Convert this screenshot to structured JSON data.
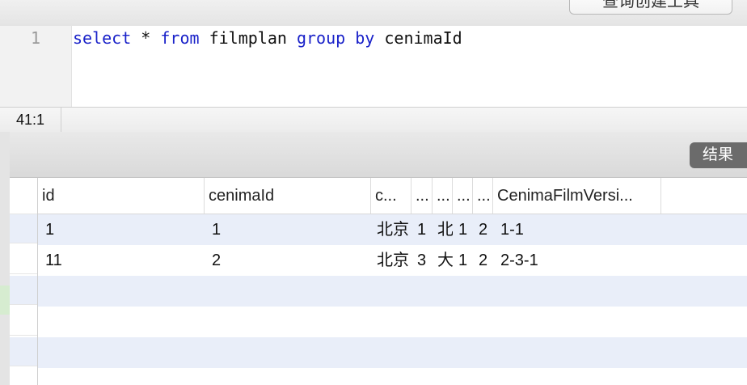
{
  "toolbar": {
    "query_builder_button": "查询创建工具"
  },
  "editor": {
    "line_number": "1",
    "sql": {
      "select": "select",
      "star": " * ",
      "from": "from",
      "table": " filmplan ",
      "group": "group",
      "space": " ",
      "by": "by",
      "column": " cenimaId"
    }
  },
  "status": {
    "cursor_position": "41:1"
  },
  "results": {
    "tab_label": "结果",
    "columns": [
      "id",
      "cenimaId",
      "c...",
      "...",
      "...",
      "...",
      "...",
      "CenimaFilmVersi..."
    ],
    "rows": [
      [
        "1",
        "1",
        "北京",
        "1",
        "北",
        "1",
        "2",
        "1-1"
      ],
      [
        "11",
        "2",
        "北京",
        "3",
        "大",
        "1",
        "2",
        "2-3-1"
      ]
    ]
  }
}
